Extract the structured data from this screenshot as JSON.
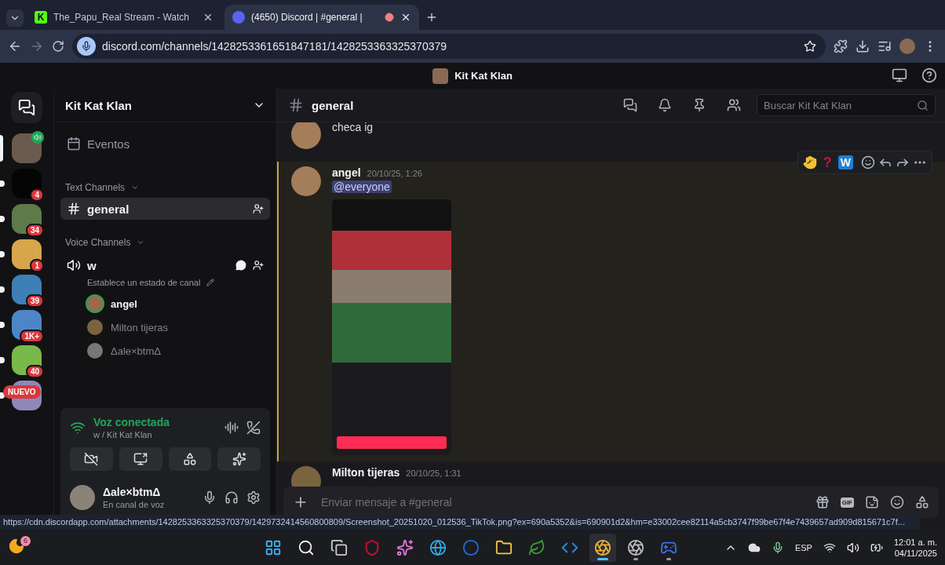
{
  "browser": {
    "tabs": [
      {
        "favicon_text": "K",
        "title": "The_Papu_Real Stream - Watch",
        "selected": false,
        "recording": false
      },
      {
        "title": "(4650) Discord | #general |",
        "selected": true,
        "recording": true
      }
    ],
    "url": "discord.com/channels/1428253361651847181/1428253363325370379"
  },
  "app_title": "Kit Kat Klan",
  "servers": [
    {
      "selected": true,
      "speaking": true
    },
    {
      "selected": false,
      "unread": true,
      "badge": "4"
    },
    {
      "selected": false,
      "unread": true,
      "badge": "34"
    },
    {
      "selected": false,
      "unread": true,
      "badge": "1"
    },
    {
      "selected": false,
      "unread": true,
      "badge": "39"
    },
    {
      "selected": false,
      "unread": true,
      "badge": "1K+"
    },
    {
      "selected": false,
      "unread": true,
      "badge": "40"
    },
    {
      "selected": false,
      "unread": true,
      "label": "NUEVO"
    }
  ],
  "sidebar": {
    "server_name": "Kit Kat Klan",
    "events": "Eventos",
    "text_category": "Text Channels",
    "text_channels": [
      {
        "name": "general",
        "selected": true
      }
    ],
    "voice_category": "Voice Channels",
    "voice_channel": {
      "name": "w",
      "status": "Establece un estado de canal",
      "members": [
        {
          "name": "angel",
          "speaking": true
        },
        {
          "name": "Milton tijeras",
          "speaking": false
        },
        {
          "name": "Δale×btmΔ",
          "speaking": false
        }
      ]
    },
    "voice_panel": {
      "title": "Voz conectada",
      "subtitle": "w / Kit Kat Klan"
    },
    "user": {
      "name": "Δale×btmΔ",
      "status": "En canal de voz"
    }
  },
  "channel": {
    "name": "general",
    "search_placeholder": "Buscar Kit Kat Klan",
    "quick_reactions": [
      {
        "kind": "icon"
      },
      {
        "kind": "text",
        "text": "?"
      },
      {
        "kind": "tile",
        "text": "W"
      }
    ],
    "messages": [
      {
        "kind": "continued",
        "text": "checa ig",
        "highlighted": false
      },
      {
        "kind": "full",
        "author": "angel",
        "time": "20/10/25, 1:26",
        "mention": "@everyone",
        "attachment": true,
        "highlighted": true
      },
      {
        "kind": "full",
        "author": "Milton tijeras",
        "time": "20/10/25, 1:31",
        "highlighted": false
      }
    ],
    "composer_placeholder": "Enviar mensaje a #general",
    "gif_label": "GIF"
  },
  "status_url": "https://cdn.discordapp.com/attachments/1428253363325370379/1429732414560800809/Screenshot_20251020_012536_TikTok.png?ex=690a5352&is=690901d2&hm=e33002cee82114a5cb3747f99be67f4e7439657ad909d815671c7f...",
  "taskbar": {
    "weather_badge": "6",
    "apps": [
      {
        "running": false,
        "active": false
      },
      {
        "running": false,
        "active": false
      },
      {
        "running": false,
        "active": false
      },
      {
        "running": false,
        "active": false
      },
      {
        "running": false,
        "active": false
      },
      {
        "running": false,
        "active": false
      },
      {
        "running": false,
        "active": false
      },
      {
        "running": false,
        "active": false
      },
      {
        "running": false,
        "active": false
      },
      {
        "running": false,
        "active": false
      },
      {
        "running": true,
        "active": true
      },
      {
        "running": true,
        "active": false
      },
      {
        "running": true,
        "active": false
      }
    ],
    "language": "ESP",
    "time": "12:01 a. m.",
    "date": "04/11/2025"
  }
}
